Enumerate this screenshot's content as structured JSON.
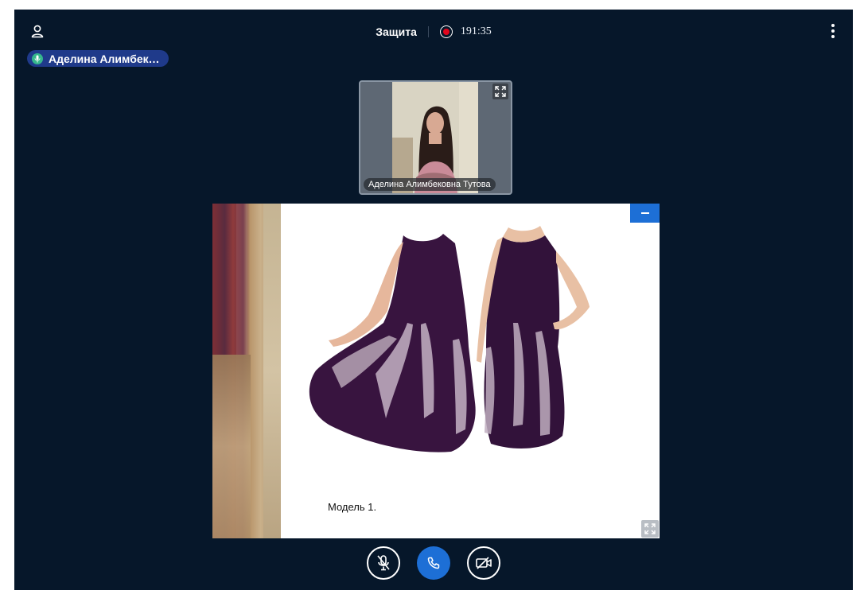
{
  "header": {
    "meeting_name": "Защита",
    "timer": "191:35",
    "user_icon": "user-icon",
    "more_icon": "more-vertical-icon",
    "recording_icon": "record-icon"
  },
  "talking_indicator": {
    "name": "Аделина Алимбеко..."
  },
  "participant": {
    "name": "Аделина Алимбековна Тутова"
  },
  "presentation": {
    "caption": "Модель 1."
  },
  "controls": {
    "mic_icon": "mic-muted-icon",
    "hangup_icon": "phone-icon",
    "camera_icon": "camera-off-icon"
  },
  "colors": {
    "background": "#06172a",
    "accent": "#1d6fd6",
    "talker_badge": "#1f3a8a",
    "recording": "#e1061d",
    "mic_active": "#35b78c"
  }
}
